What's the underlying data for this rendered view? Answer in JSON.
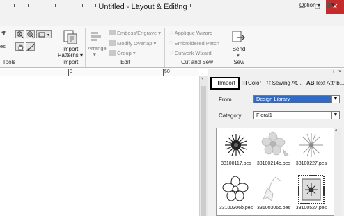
{
  "window": {
    "title": "Untitled - Layout & Editing",
    "minimize": "–",
    "maximize": "□",
    "close": "✕"
  },
  "option_bar": {
    "label": "Option ▾",
    "help": "▾"
  },
  "ribbon": {
    "groups": {
      "tools": "Tools",
      "import": "Import",
      "edit": "Edit",
      "cut_and_sew": "Cut and Sew",
      "sew": "Sew"
    },
    "tools_partial_label": "es",
    "import_patterns": "Import\nPatterns ▾",
    "arrange": "Arrange",
    "emboss_engrave": "Emboss/Engrave ▾",
    "modify_overlap": "Modify Overlap ▾",
    "group": "Group ▾",
    "applique_wizard": "Applique Wizard",
    "embroidered_patch": "Embroidered Patch",
    "cutwork_wizard": "Cutwork Wizard",
    "send": "Send"
  },
  "ruler": {
    "labels": [
      "0",
      "50"
    ]
  },
  "panel": {
    "tabs": [
      {
        "label": "Import"
      },
      {
        "label": "Color"
      },
      {
        "label": "Sewing At..."
      },
      {
        "label": "Text Attrib..."
      }
    ],
    "from_label": "From",
    "from_value": "Design Library",
    "category_label": "Category",
    "category_value": "Floral1",
    "thumbnails": [
      {
        "label": "33100117.pes"
      },
      {
        "label": "33100214b.pes"
      },
      {
        "label": "33100227.pes"
      },
      {
        "label": "33100306b.pes"
      },
      {
        "label": "33100306c.pes"
      },
      {
        "label": "33100527.pes"
      }
    ]
  }
}
